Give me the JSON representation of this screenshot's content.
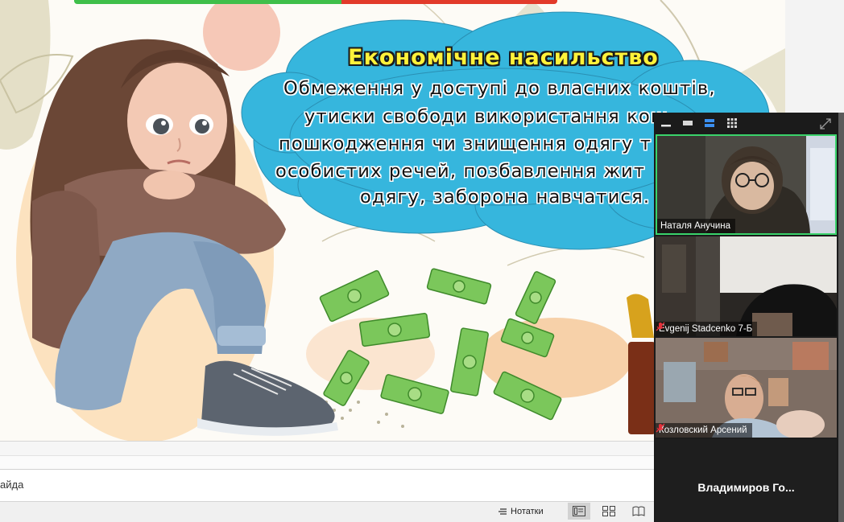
{
  "slide": {
    "title": "Економічне насильство",
    "body_lines": [
      "Обмеження у доступі до власних коштів,",
      "утиски свободи використання кош",
      "пошкодження чи знищення одягу т",
      "особистих речей, позбавлення жит",
      "одягу, заборона навчатися."
    ],
    "progress": {
      "green_color": "#3fbf4a",
      "red_color": "#e23a2a"
    },
    "cloud_color": "#36b6dd"
  },
  "app": {
    "notes_pane_text": "айда",
    "notes_button_label": "Нотатки",
    "view_buttons": [
      "normal-view",
      "slide-sorter-view",
      "reading-view"
    ]
  },
  "video_panel": {
    "toolbar_icons": [
      "minimize-icon",
      "single-speaker-icon",
      "side-by-side-icon",
      "gallery-grid-icon",
      "expand-icon"
    ],
    "participants": [
      {
        "name": "Наталя Анучина",
        "muted": false,
        "active_speaker": true
      },
      {
        "name": "Evgenij Stadcenko 7-Б",
        "muted": true,
        "active_speaker": false
      },
      {
        "name": "Козловский Арсений",
        "muted": true,
        "active_speaker": false
      },
      {
        "name": "Владимиров  Го...",
        "muted": false,
        "video_off": true
      }
    ],
    "active_border_color": "#3ad36b"
  }
}
